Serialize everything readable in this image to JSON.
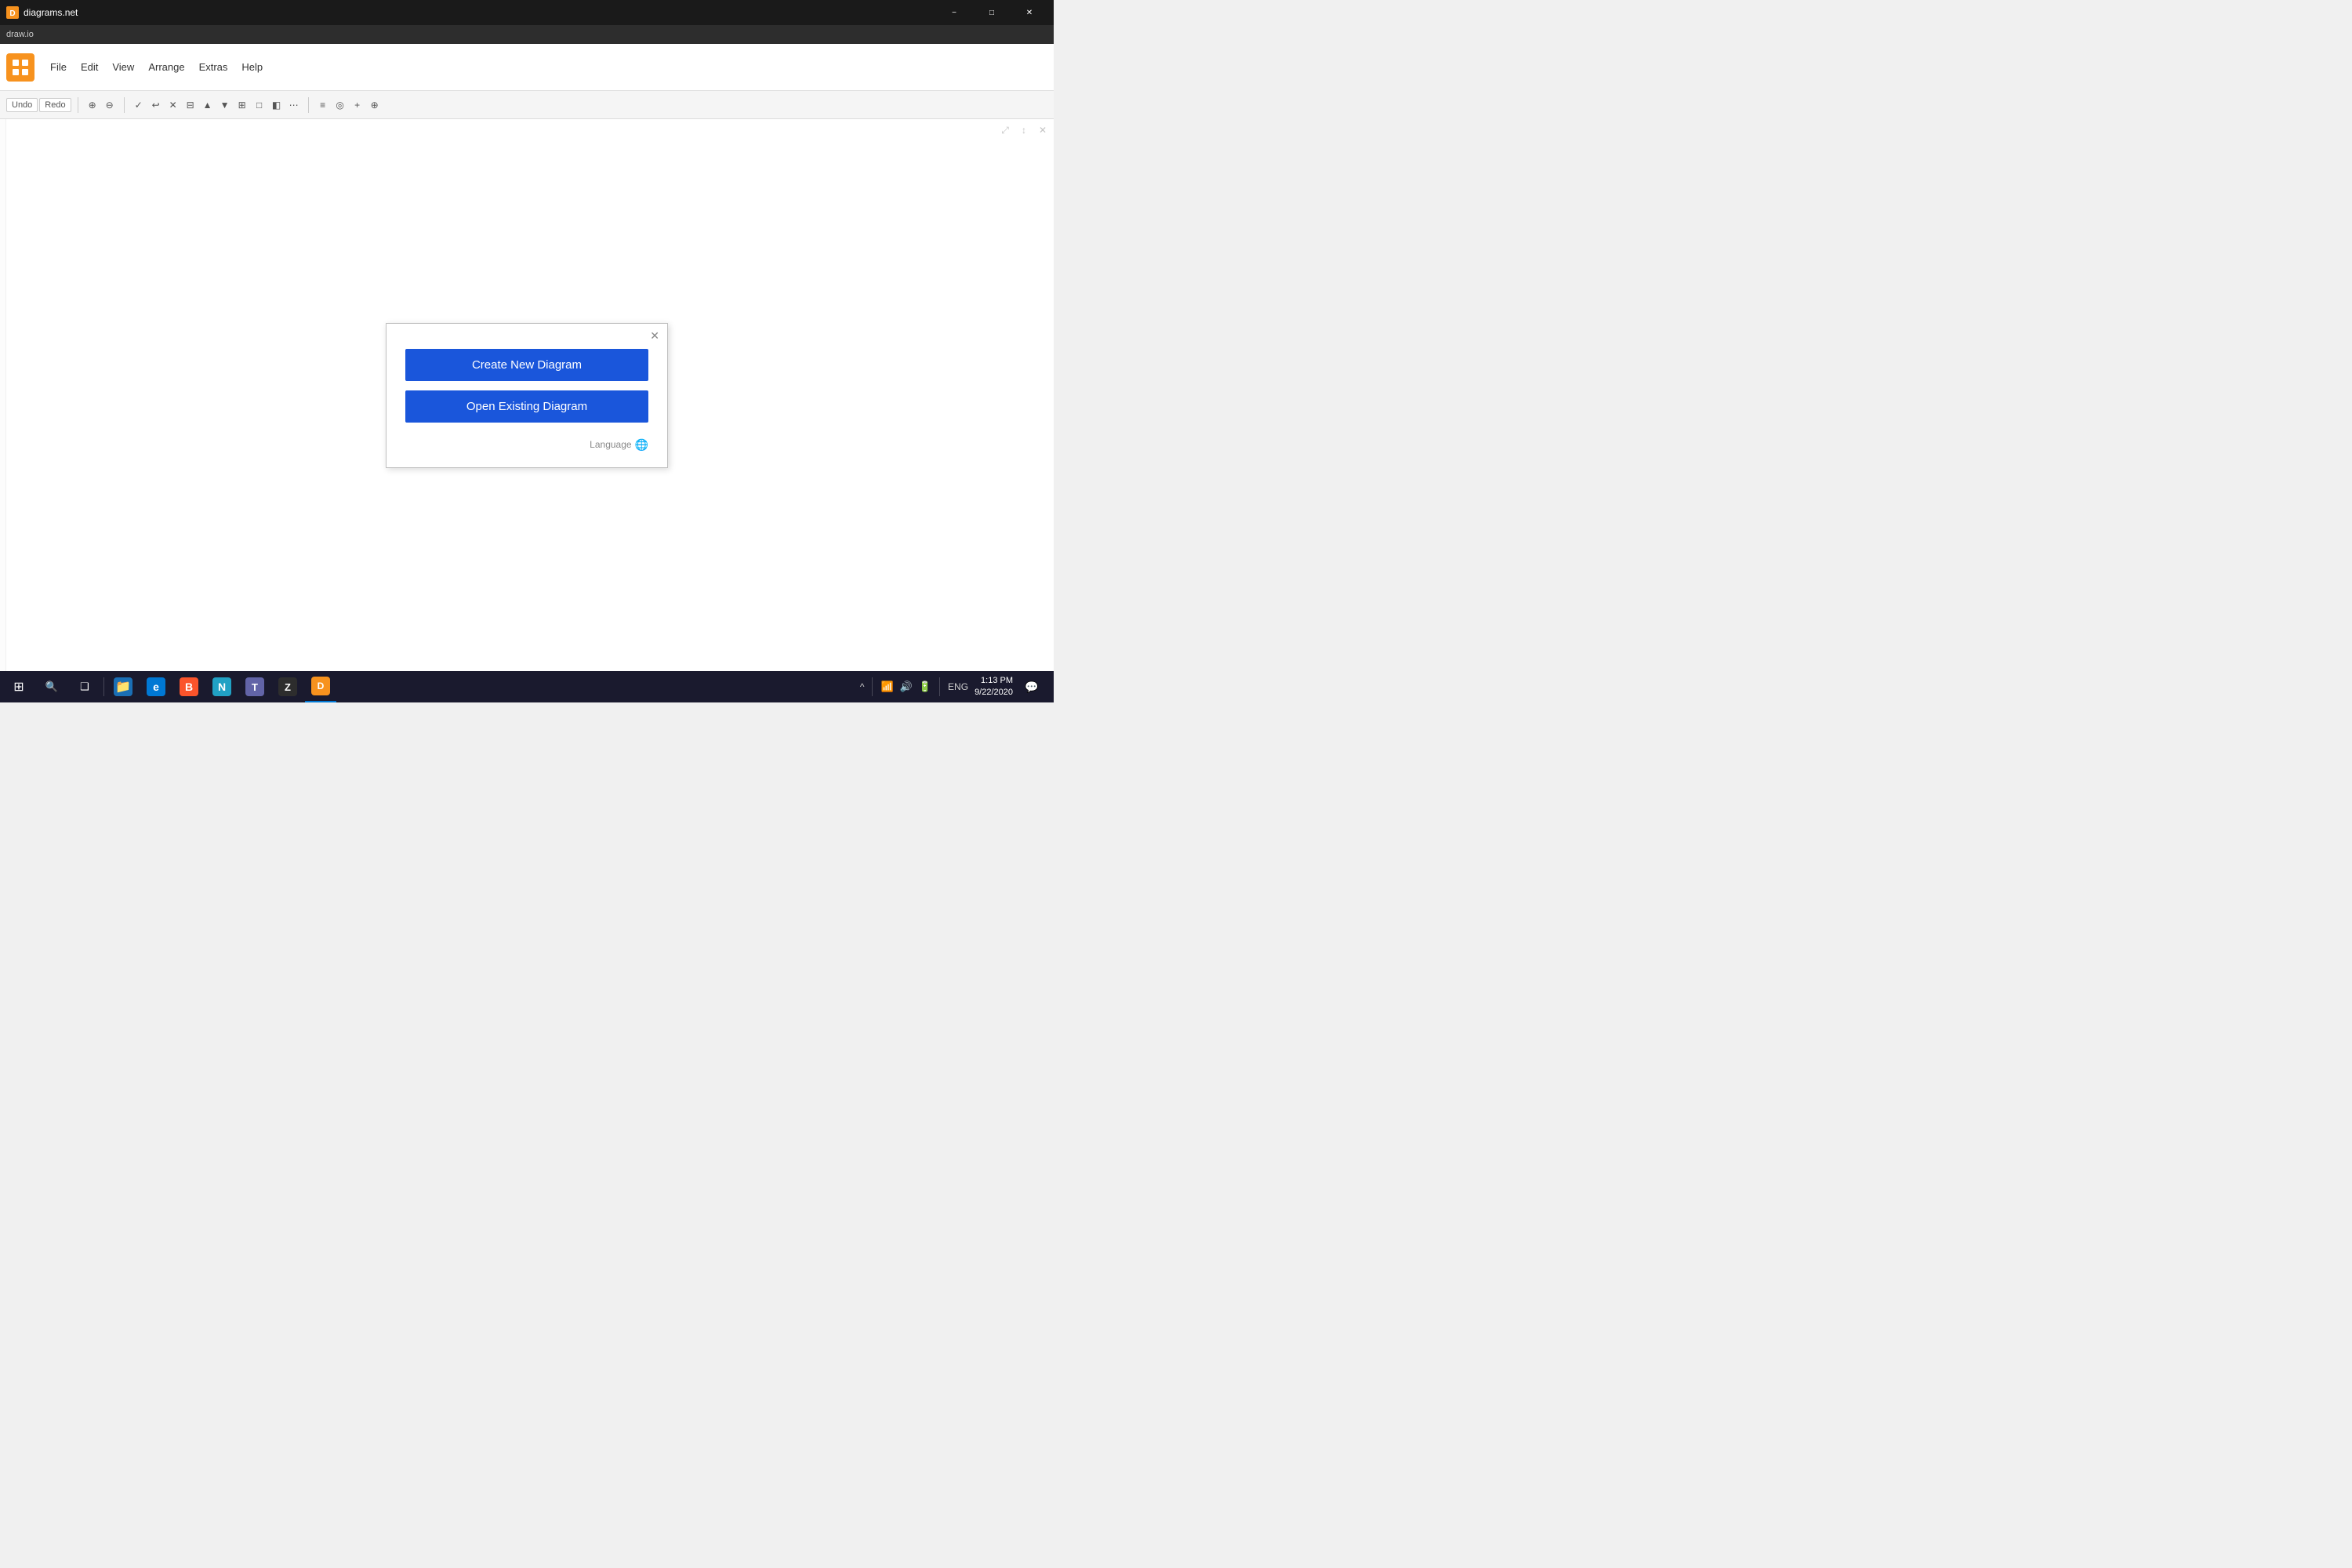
{
  "titlebar": {
    "app_name": "diagrams.net",
    "address": "draw.io",
    "minimize_label": "−",
    "maximize_label": "□",
    "close_label": "✕"
  },
  "menubar": {
    "items": [
      {
        "label": "File"
      },
      {
        "label": "Edit"
      },
      {
        "label": "View"
      },
      {
        "label": "Arrange"
      },
      {
        "label": "Extras"
      },
      {
        "label": "Help"
      }
    ]
  },
  "toolbar": {
    "undo_label": "Undo",
    "redo_label": "Redo",
    "zoom_in_label": "⊕",
    "zoom_out_label": "⊖",
    "fit_label": "⤢",
    "reset_label": "↺",
    "insert_label": "+",
    "delete_label": "✕"
  },
  "dialog": {
    "close_label": "✕",
    "create_btn_label": "Create New Diagram",
    "open_btn_label": "Open Existing Diagram",
    "language_label": "Language",
    "globe_icon": "🌐"
  },
  "taskbar": {
    "start_icon": "⊞",
    "search_icon": "🔍",
    "task_view_icon": "❑",
    "apps": [
      {
        "name": "explorer",
        "icon": "📁",
        "color": "#f0b429"
      },
      {
        "name": "edge",
        "icon": "🌐",
        "color": "#0078d4"
      },
      {
        "name": "teams",
        "icon": "T",
        "color": "#6264a7"
      },
      {
        "name": "terminal",
        "icon": "Z",
        "color": "#1a1a1a"
      },
      {
        "name": "diagrams",
        "icon": "D",
        "color": "#f7921e"
      }
    ],
    "tray": {
      "chevron": "^",
      "network": "📶",
      "volume": "🔊",
      "battery": "🔋",
      "language": "ENG"
    },
    "clock": {
      "time": "1:13 PM",
      "date": "9/22/2020"
    },
    "notification_icon": "💬"
  },
  "canvas": {
    "top_right_icons": [
      "⊞",
      "↕",
      "✕"
    ]
  }
}
